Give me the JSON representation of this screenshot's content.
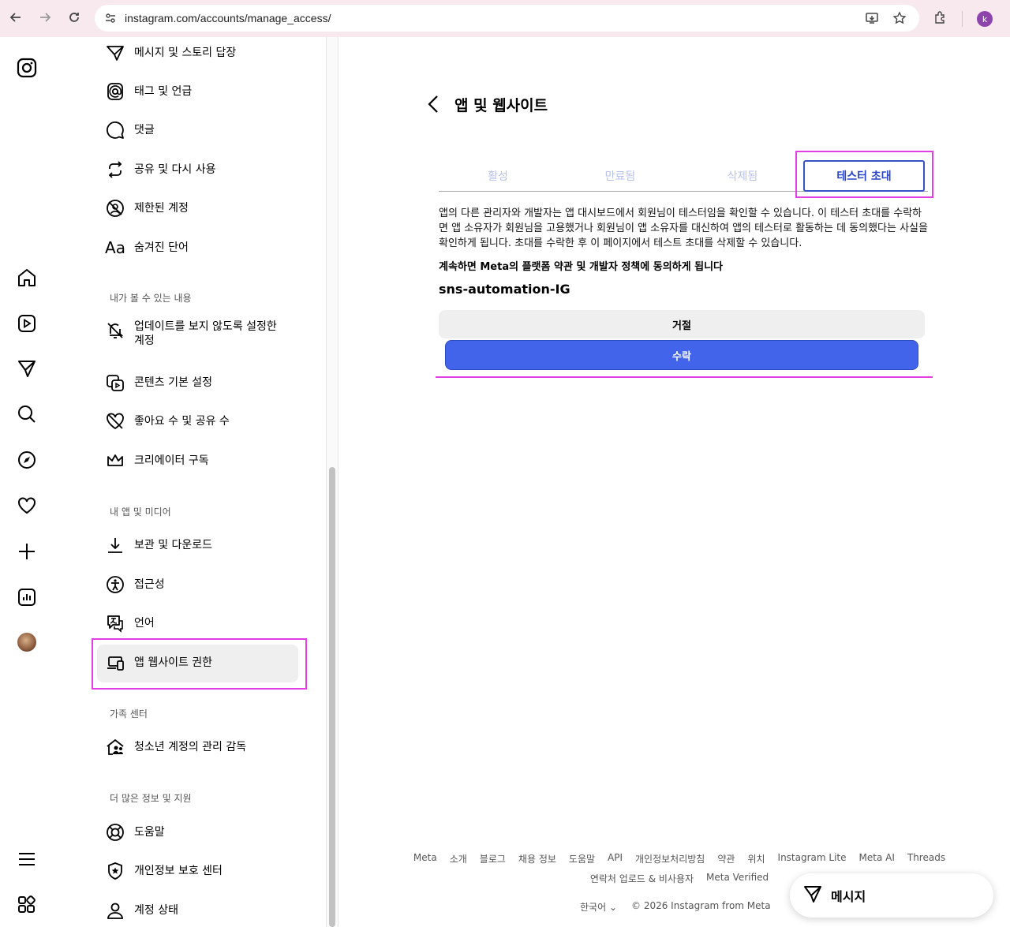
{
  "browser": {
    "url": "instagram.com/accounts/manage_access/",
    "profile_initial": "k"
  },
  "settings": {
    "items_top": [
      {
        "label": "메시지 및 스토리 답장",
        "icon": "send-icon"
      },
      {
        "label": "태그 및 언급",
        "icon": "at-icon"
      },
      {
        "label": "댓글",
        "icon": "comment-icon"
      },
      {
        "label": "공유 및 다시 사용",
        "icon": "repost-icon"
      },
      {
        "label": "제한된 계정",
        "icon": "restricted-icon"
      },
      {
        "label": "숨겨진 단어",
        "icon": "text-aa-icon"
      }
    ],
    "section_view": "내가 볼 수 있는 내용",
    "items_view": [
      {
        "label": "업데이트를 보지 않도록 설정한\n계정",
        "icon": "muted-bell-icon"
      },
      {
        "label": "콘텐츠 기본 설정",
        "icon": "content-icon"
      },
      {
        "label": "좋아요 수 및 공유 수",
        "icon": "heart-off-icon"
      },
      {
        "label": "크리에이터 구독",
        "icon": "crown-icon"
      }
    ],
    "section_media": "내 앱 및 미디어",
    "items_media": [
      {
        "label": "보관 및 다운로드",
        "icon": "download-icon"
      },
      {
        "label": "접근성",
        "icon": "accessibility-icon"
      },
      {
        "label": "언어",
        "icon": "language-icon"
      },
      {
        "label": "앱 웹사이트 권한",
        "icon": "devices-icon"
      }
    ],
    "section_family": "가족 센터",
    "items_family": [
      {
        "label": "청소년 계정의 관리 감독",
        "icon": "family-icon"
      }
    ],
    "section_more": "더 많은 정보 및 지원",
    "items_more": [
      {
        "label": "도움말",
        "icon": "lifebuoy-icon"
      },
      {
        "label": "개인정보 보호 센터",
        "icon": "shield-icon"
      },
      {
        "label": "계정 상태",
        "icon": "user-icon"
      }
    ]
  },
  "main": {
    "title": "앱 및 웹사이트",
    "tabs": [
      "활성",
      "만료됨",
      "삭제됨",
      "테스터 초대"
    ],
    "active_tab": "테스터 초대",
    "description": "앱의 다른 관리자와 개발자는 앱 대시보드에서 회원님이 테스터임을 확인할 수 있습니다. 이 테스터 초대를 수락하면 앱 소유자가 회원님을 고용했거나 회원님이 앱 소유자를 대신하여 앱의 테스터로 활동하는 데 동의했다는 사실을 확인하게 됩니다. 초대를 수락한 후 이 페이지에서 테스트 초대를 삭제할 수 있습니다.",
    "agree_text": "계속하면 Meta의 플랫폼 약관 및 개발자 정책에 동의하게 됩니다",
    "app_name": "sns-automation-IG",
    "reject_label": "거절",
    "accept_label": "수락"
  },
  "footer": {
    "links_row1": [
      "Meta",
      "소개",
      "블로그",
      "채용 정보",
      "도움말",
      "API",
      "개인정보처리방침",
      "약관",
      "위치",
      "Instagram Lite",
      "Meta AI",
      "Threads"
    ],
    "links_row2": [
      "연락처 업로드 & 비사용자",
      "Meta Verified"
    ],
    "language": "한국어",
    "copyright": "© 2026 Instagram from Meta"
  },
  "messages_button": "메시지",
  "colors": {
    "accent": "#4264ea",
    "tab_active": "#2a45c9",
    "highlight": "#e33ee6"
  }
}
